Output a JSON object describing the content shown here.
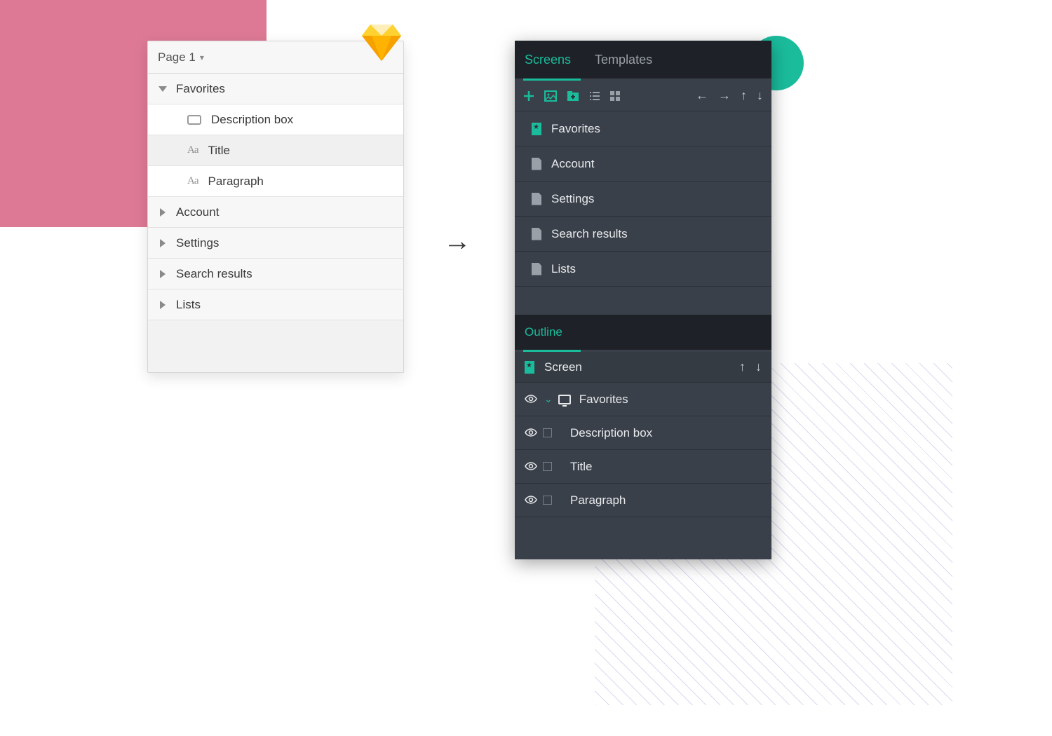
{
  "colors": {
    "accent": "#1abc9c",
    "pink": "#dd7994",
    "dark_bg": "#3a4049"
  },
  "sketch_panel": {
    "page_label": "Page 1",
    "groups": [
      {
        "label": "Favorites",
        "expanded": true,
        "children": [
          {
            "icon": "rectangle",
            "label": "Description box"
          },
          {
            "icon": "text",
            "label": "Title"
          },
          {
            "icon": "text",
            "label": "Paragraph"
          }
        ]
      },
      {
        "label": "Account",
        "expanded": false
      },
      {
        "label": "Settings",
        "expanded": false
      },
      {
        "label": "Search results",
        "expanded": false
      },
      {
        "label": "Lists",
        "expanded": false
      }
    ]
  },
  "dark_panel": {
    "tabs": [
      "Screens",
      "Templates"
    ],
    "active_tab": "Screens",
    "screens": [
      "Favorites",
      "Account",
      "Settings",
      "Search results",
      "Lists"
    ],
    "outline_label": "Outline",
    "outline_header": "Screen",
    "outline_tree": {
      "root": "Favorites",
      "children": [
        "Description box",
        "Title",
        "Paragraph"
      ]
    }
  }
}
